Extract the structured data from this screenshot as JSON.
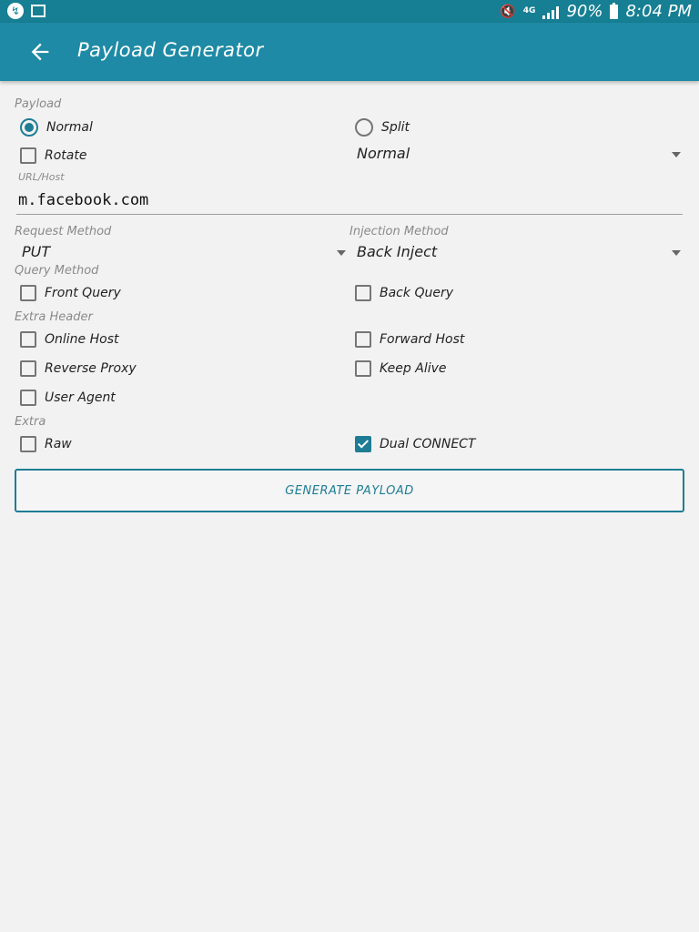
{
  "status_bar": {
    "left_icons": [
      "messenger-icon",
      "book-icon"
    ],
    "network": "4G",
    "battery": "90%",
    "time": "8:04 PM"
  },
  "app_bar": {
    "title": "Payload Generator",
    "back_icon": "arrow-left-icon"
  },
  "payload": {
    "label": "Payload",
    "normal_label": "Normal",
    "normal_selected": true,
    "split_label": "Split",
    "split_selected": false,
    "rotate_label": "Rotate",
    "rotate_checked": false,
    "split_mode_value": "Normal"
  },
  "url_host": {
    "label": "URL/Host",
    "value": "m.facebook.com"
  },
  "request_method": {
    "label": "Request Method",
    "value": "PUT"
  },
  "injection_method": {
    "label": "Injection Method",
    "value": "Back Inject"
  },
  "query_method": {
    "label": "Query Method",
    "front_query": "Front Query",
    "front_query_checked": false,
    "back_query": "Back Query",
    "back_query_checked": false
  },
  "extra_header": {
    "label": "Extra Header",
    "online_host": "Online Host",
    "forward_host": "Forward Host",
    "reverse_proxy": "Reverse Proxy",
    "keep_alive": "Keep Alive",
    "user_agent": "User Agent"
  },
  "extra": {
    "label": "Extra",
    "raw": "Raw",
    "raw_checked": false,
    "dual_connect": "Dual CONNECT",
    "dual_connect_checked": true
  },
  "generate_button": "GENERATE PAYLOAD",
  "colors": {
    "status_bar": "#167f93",
    "app_bar": "#1e8aa5",
    "accent": "#1e7d94",
    "background": "#f2f2f2"
  }
}
